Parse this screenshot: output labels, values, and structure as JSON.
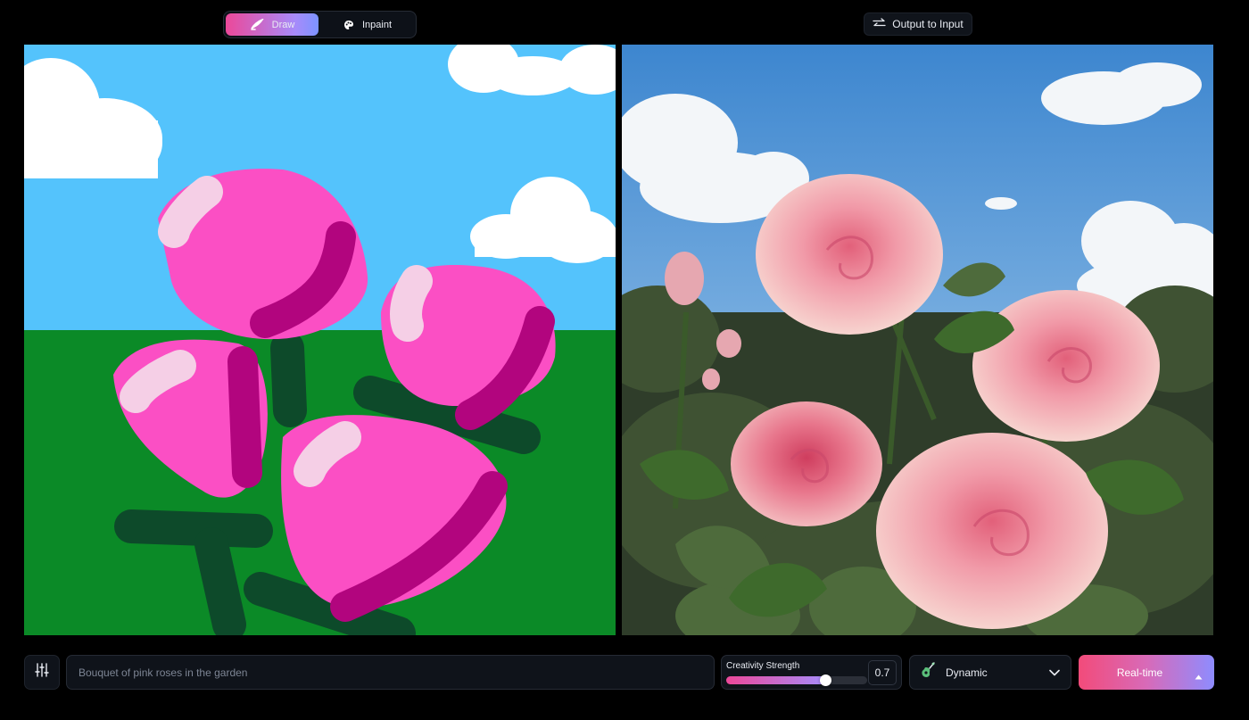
{
  "mode_toggle": {
    "draw_label": "Draw",
    "inpaint_label": "Inpaint",
    "selected": "Draw"
  },
  "output_to_input_label": "Output to Input",
  "prompt": {
    "placeholder": "Bouquet of pink roses in the garden",
    "value": ""
  },
  "creativity": {
    "label": "Creativity Strength",
    "value": "0.7",
    "level": 0.7
  },
  "style_select": {
    "value": "Dynamic"
  },
  "generate_button": {
    "label": "Real-time"
  },
  "colors": {
    "accent_pink": "#ec4899",
    "accent_violet": "#a78bfa",
    "panel_bg": "#0f131a",
    "sketch_sky": "#54c3fc",
    "sketch_grass": "#0b8a27",
    "sketch_petal": "#fb4fc4",
    "sketch_stem": "#0d4a2a"
  },
  "icons": {
    "draw": "brush-icon",
    "inpaint": "palette-icon",
    "output": "swap-arrows-icon",
    "settings": "sliders-icon",
    "style": "guitar-icon",
    "style_chevron": "chevron-down-icon",
    "generate_caret": "caret-up-icon"
  }
}
